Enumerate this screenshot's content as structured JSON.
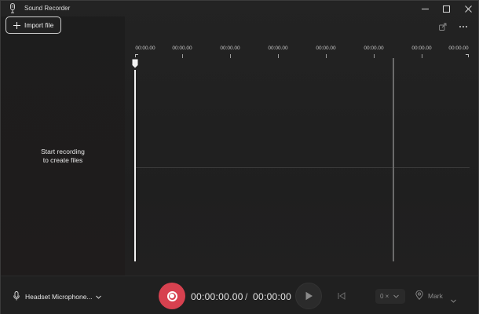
{
  "window": {
    "title": "Sound Recorder"
  },
  "toolbar": {
    "import_label": "Import file"
  },
  "left_panel": {
    "empty_line1": "Start recording",
    "empty_line2": "to create files"
  },
  "timeline": {
    "tick_labels": [
      "00:00.00",
      "00:00.00",
      "00:00.00",
      "00:00.00",
      "00:00.00",
      "00:00.00",
      "00:00.00",
      "00:00.00"
    ]
  },
  "controls": {
    "microphone": "Headset Microphone...",
    "current_time": "00:00:00.00",
    "separator": "/",
    "total_time": "00:00:00",
    "speed": "0 ×",
    "mark_label": "Mark"
  },
  "colors": {
    "record": "#d7414f",
    "background": "#202020"
  },
  "icons": {
    "app": "microphone-icon",
    "import": "plus-icon",
    "share": "share-icon",
    "more": "more-icon",
    "mic": "microphone-icon",
    "record": "record-icon",
    "play": "play-icon",
    "skip": "skip-back-icon",
    "mark": "location-pin-icon"
  }
}
